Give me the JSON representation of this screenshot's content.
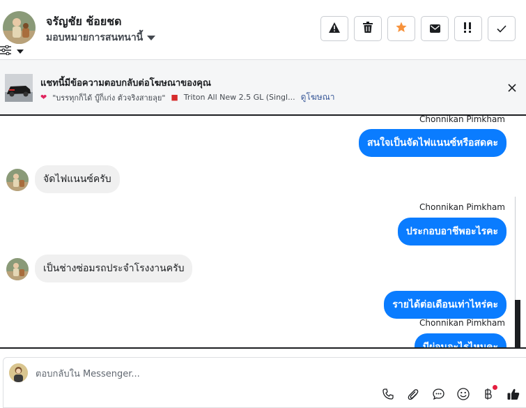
{
  "header": {
    "contact_name": "จรัญชัย ช้อยชด",
    "assign_label": "มอบหมายการสนทนานี้",
    "actions": [
      {
        "icon": "warning-icon"
      },
      {
        "icon": "trash-icon"
      },
      {
        "icon": "star-icon"
      },
      {
        "icon": "envelope-icon"
      },
      {
        "icon": "follow-up-icon"
      },
      {
        "icon": "check-icon"
      }
    ]
  },
  "ad_banner": {
    "title": "แชทนี้มีข้อความตอบกลับต่อโฆษณาของคุณ",
    "quote": "\"บรรทุกก็ได้ บู๊ก็เก่ง ตัวจริงสายลุย\"",
    "product": "Triton All New 2.5 GL (Singl...",
    "link": "ดูโฆษณา"
  },
  "messages": [
    {
      "direction": "out",
      "sender": "Chonnikan Pimkham",
      "text": "สนใจเป็นจัดไฟแนนซ์หรือสดคะ"
    },
    {
      "direction": "in",
      "text": "จัดไฟแนนซ์ครับ"
    },
    {
      "direction": "out",
      "sender": "Chonnikan Pimkham",
      "text": "ประกอบอาชีพอะไรคะ"
    },
    {
      "direction": "in",
      "text": "เป็นช่างซ่อมรถประจำโรงงานครับ"
    },
    {
      "direction": "out",
      "text": "รายได้ต่อเดือนเท่าไหร่คะ"
    },
    {
      "direction": "out",
      "sender": "Chonnikan Pimkham",
      "text": "มีผ่อนอะไรไหมคะ"
    }
  ],
  "composer": {
    "placeholder": "ตอบกลับใน Messenger..."
  },
  "colors": {
    "accent": "#0a7cff",
    "star": "#f7923b",
    "badge": "#e41e3f"
  }
}
